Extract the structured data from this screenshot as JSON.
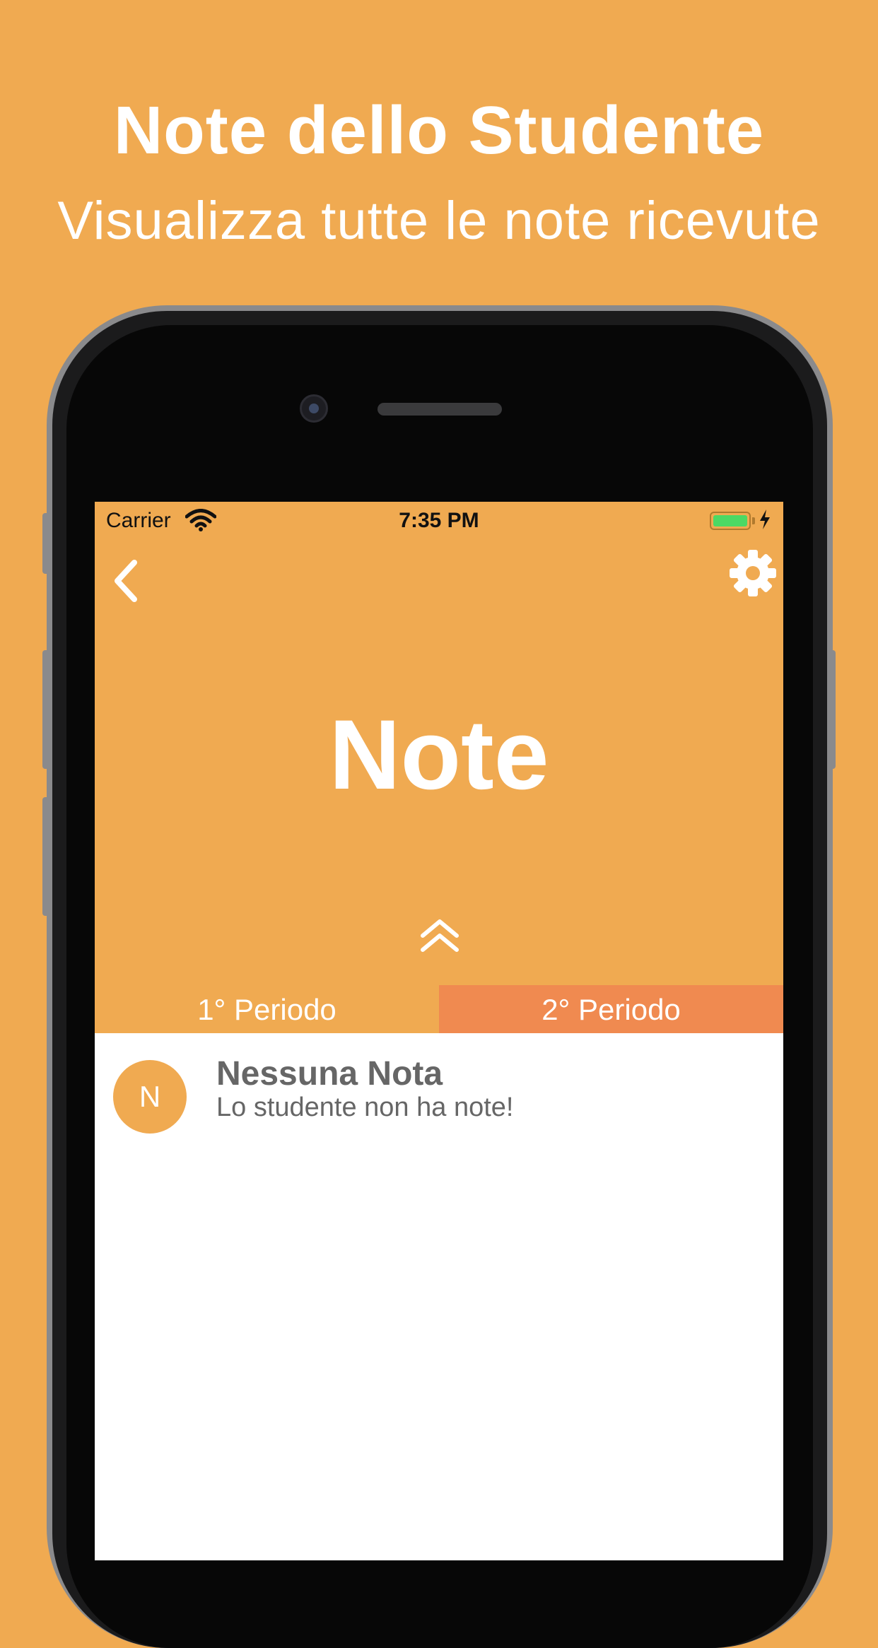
{
  "promo": {
    "title": "Note dello Studente",
    "subtitle": "Visualizza tutte le note ricevute"
  },
  "status_bar": {
    "carrier": "Carrier",
    "time": "7:35 PM",
    "battery_level": 1.0
  },
  "header": {
    "title": "Note",
    "back_icon": "chevron-left-icon",
    "settings_icon": "gear-icon",
    "expand_icon": "double-chevron-up-icon"
  },
  "tabs": [
    {
      "label": "1° Periodo",
      "active": false
    },
    {
      "label": "2° Periodo",
      "active": true
    }
  ],
  "notes": [
    {
      "avatar": "N",
      "title": "Nessuna Nota",
      "subtitle": "Lo studente non ha note!"
    }
  ],
  "colors": {
    "background": "#F0AA51",
    "active_tab": "#F08A50",
    "text_on_accent": "#FFFFFF"
  }
}
